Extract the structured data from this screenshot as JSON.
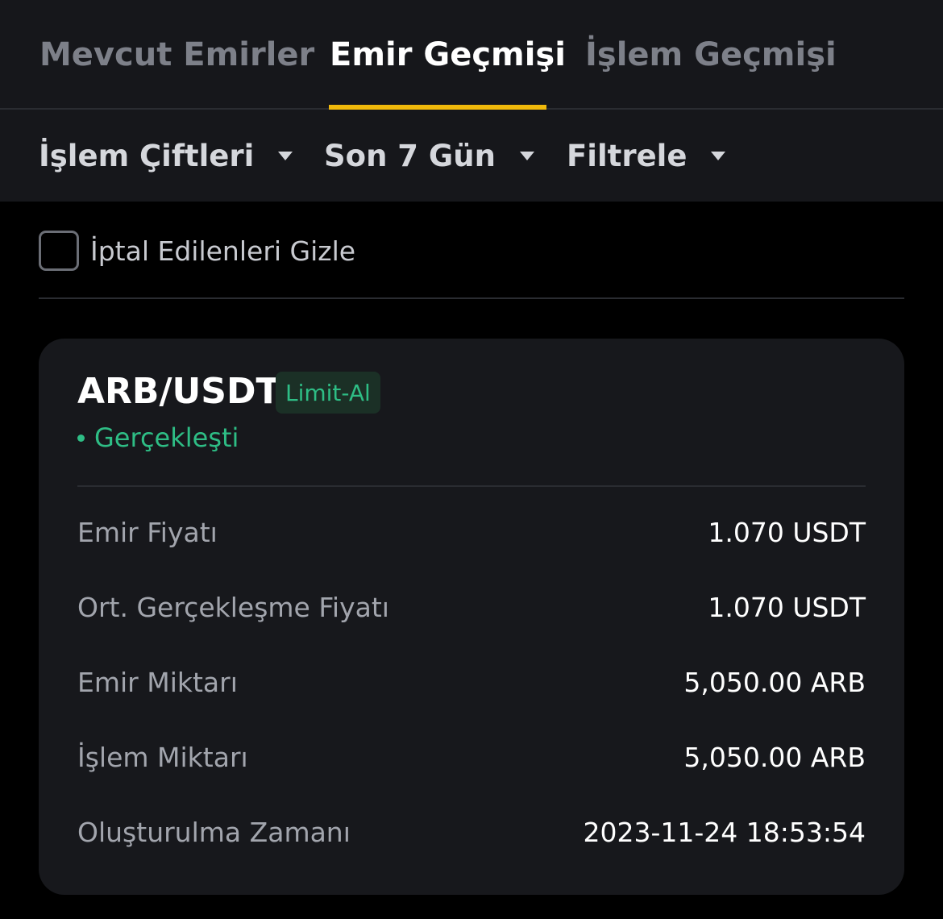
{
  "tabs": [
    {
      "label": "Mevcut Emirler",
      "active": false
    },
    {
      "label": "Emir Geçmişi",
      "active": true
    },
    {
      "label": "İşlem Geçmişi",
      "active": false
    }
  ],
  "filters": [
    {
      "label": "İşlem Çiftleri"
    },
    {
      "label": "Son 7 Gün"
    },
    {
      "label": "Filtrele"
    }
  ],
  "hide_cancelled": {
    "label": "İptal Edilenleri Gizle",
    "checked": false
  },
  "order": {
    "pair": "ARB/USDT",
    "type_badge": "Limit-Al",
    "status": "Gerçekleşti",
    "details": [
      {
        "label": "Emir Fiyatı",
        "value": "1.070 USDT"
      },
      {
        "label": "Ort. Gerçekleşme Fiyatı",
        "value": "1.070 USDT"
      },
      {
        "label": "Emir Miktarı",
        "value": "5,050.00 ARB"
      },
      {
        "label": "İşlem Miktarı",
        "value": "5,050.00 ARB"
      },
      {
        "label": "Oluşturulma Zamanı",
        "value": "2023-11-24 18:53:54"
      }
    ]
  },
  "colors": {
    "accent": "#f0b90b",
    "buy_green": "#2ebd85",
    "background": "#000000",
    "panel": "#16171b",
    "card": "#17181c"
  }
}
